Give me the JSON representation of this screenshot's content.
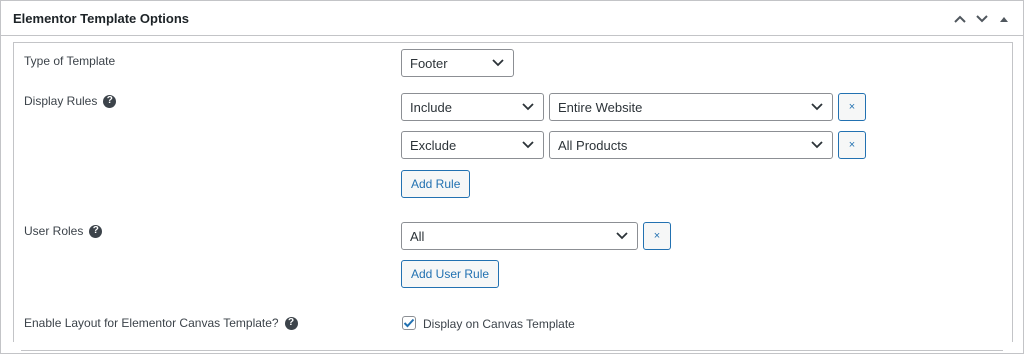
{
  "metabox": {
    "title": "Elementor Template Options",
    "actions": {
      "up_icon": "chevron-up-icon",
      "down_icon": "chevron-down-icon",
      "toggle_icon": "triangle-up-icon"
    }
  },
  "template_type": {
    "label": "Type of Template",
    "selected": "Footer"
  },
  "display_rules": {
    "label": "Display Rules",
    "help": "?",
    "rules": [
      {
        "condition": "Include",
        "target": "Entire Website",
        "remove": "×"
      },
      {
        "condition": "Exclude",
        "target": "All Products",
        "remove": "×"
      }
    ],
    "add_rule_label": "Add Rule"
  },
  "user_roles": {
    "label": "User Roles",
    "help": "?",
    "selected": "All",
    "remove": "×",
    "add_user_rule_label": "Add User Rule"
  },
  "canvas": {
    "label": "Enable Layout for Elementor Canvas Template?",
    "help": "?",
    "checkbox_label": "Display on Canvas Template",
    "checked": true
  },
  "colors": {
    "accent": "#2271b1",
    "border": "#8c8f94",
    "text": "#3c434a"
  }
}
